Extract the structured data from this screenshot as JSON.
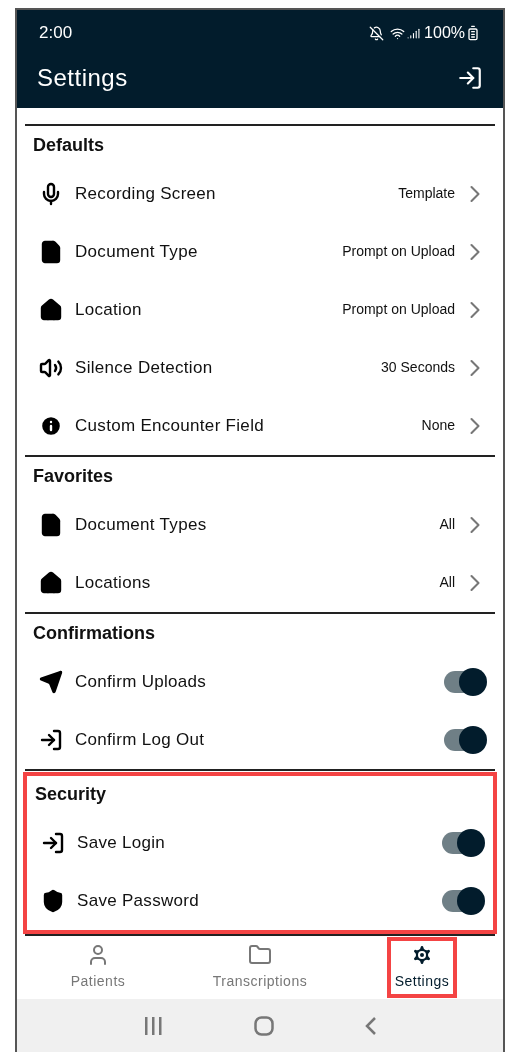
{
  "status_bar": {
    "time": "2:00",
    "battery": "100%"
  },
  "header": {
    "title": "Settings"
  },
  "sections": [
    {
      "title": "Defaults",
      "highlighted": false,
      "rows": [
        {
          "kind": "value",
          "label": "Recording Screen",
          "value": "Template"
        },
        {
          "kind": "value",
          "label": "Document Type",
          "value": "Prompt on Upload"
        },
        {
          "kind": "value",
          "label": "Location",
          "value": "Prompt on Upload"
        },
        {
          "kind": "value",
          "label": "Silence Detection",
          "value": "30 Seconds"
        },
        {
          "kind": "value",
          "label": "Custom Encounter Field",
          "value": "None"
        }
      ]
    },
    {
      "title": "Favorites",
      "highlighted": false,
      "rows": [
        {
          "kind": "value",
          "label": "Document Types",
          "value": "All"
        },
        {
          "kind": "value",
          "label": "Locations",
          "value": "All"
        }
      ]
    },
    {
      "title": "Confirmations",
      "highlighted": false,
      "rows": [
        {
          "kind": "toggle",
          "label": "Confirm Uploads",
          "on": true
        },
        {
          "kind": "toggle",
          "label": "Confirm Log Out",
          "on": true
        }
      ]
    },
    {
      "title": "Security",
      "highlighted": true,
      "rows": [
        {
          "kind": "toggle",
          "label": "Save Login",
          "on": true
        },
        {
          "kind": "toggle",
          "label": "Save Password",
          "on": true
        }
      ]
    }
  ],
  "nav": [
    {
      "label": "Patients",
      "selected": false,
      "highlighted": false
    },
    {
      "label": "Transcriptions",
      "selected": false,
      "highlighted": false
    },
    {
      "label": "Settings",
      "selected": true,
      "highlighted": true
    }
  ]
}
